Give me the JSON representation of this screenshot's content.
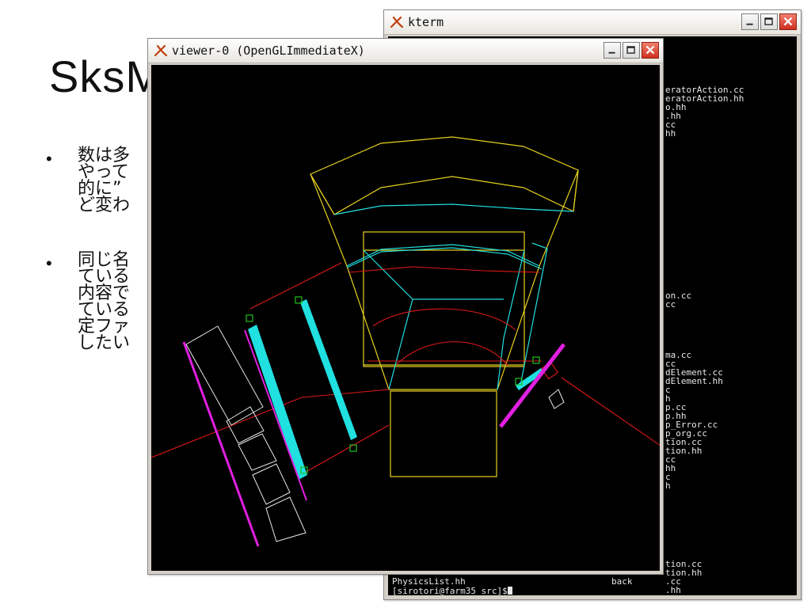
{
  "slide": {
    "title": "SksM",
    "bullets": [
      {
        "symbol": "•",
        "lines": [
          "数は多",
          "やって",
          "的に”",
          "ど変わ"
        ]
      },
      {
        "symbol": "•",
        "lines": [
          "同じ名",
          "ている",
          "内容で",
          "ている",
          "定ファ",
          "したい"
        ]
      }
    ]
  },
  "kterm": {
    "title": "kterm",
    "icon": "x-logo-icon",
    "right_lines": [
      "eratorAction.cc",
      "eratorAction.hh",
      "o.hh",
      ".hh",
      "cc",
      "hh",
      "on.cc",
      "cc",
      "ma.cc",
      "cc",
      "dElement.cc",
      "dElement.hh",
      "c",
      "h",
      "p.cc",
      "p.hh",
      "p_Error.cc",
      "p_org.cc",
      "tion.cc",
      "tion.hh",
      "cc",
      "hh",
      "c",
      "h",
      "tion.cc",
      "tion.hh",
      ".cc",
      ".hh"
    ],
    "bottom_line_left": "PhysicsList.hh",
    "bottom_line_right": "back",
    "prompt": "[sirotori@farm35 src]$"
  },
  "viewer": {
    "title": "viewer-0 (OpenGLImmediateX)",
    "icon": "x-logo-icon"
  },
  "colors": {
    "yellow": "#e6d020",
    "cyan": "#20e0e0",
    "red": "#e01818",
    "magenta": "#e020e0",
    "white": "#e8e8e8",
    "green": "#20c020"
  }
}
